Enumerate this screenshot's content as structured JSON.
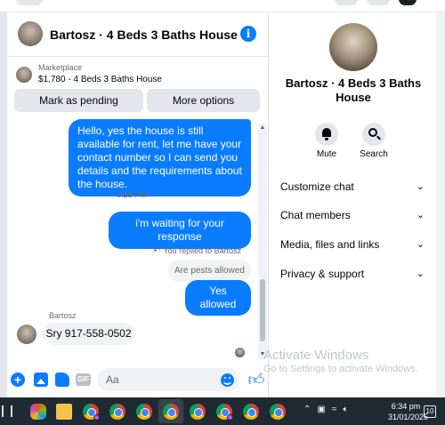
{
  "chat": {
    "title": "Bartosz · 4 Beds 3 Baths House",
    "marketplace_label": "Marketplace",
    "marketplace_item": "$1,780 - 4 Beds 3 Baths House",
    "mark_pending_label": "Mark as pending",
    "more_options_label": "More options"
  },
  "messages": {
    "outgoing_1": "Hello, yes the house is still available for rent, let me have your contact number so I can send you details and the requirements about the house.",
    "timestamp": "6:25 PM",
    "outgoing_2": "i'm waiting for your response",
    "replied_note": "You replied to Bartosz",
    "quoted": "Are pests allowed",
    "outgoing_reply": "Yes allowed",
    "incoming_sender": "Bartosz",
    "incoming_1": "Sry 917-558-0502"
  },
  "composer": {
    "placeholder": "Aa",
    "gif_label": "GIF"
  },
  "info_panel": {
    "title": "Bartosz · 4 Beds 3 Baths House",
    "mute_label": "Mute",
    "search_label": "Search",
    "rows": [
      "Customize chat",
      "Chat members",
      "Media, files and links",
      "Privacy & support"
    ]
  },
  "watermark": {
    "line1": "Activate Windows",
    "line2": "Go to Settings to activate Windows."
  },
  "taskbar": {
    "time": "6:34 pm",
    "date": "31/01/2025",
    "notification_count": "10"
  },
  "icons": {
    "info": "info-icon",
    "plus": "plus-icon",
    "image": "image-icon",
    "sticker": "sticker-icon",
    "emoji": "emoji-icon",
    "like": "thumbs-up-icon",
    "mute": "bell-icon",
    "search": "search-icon"
  },
  "colors": {
    "accent": "#0a7cff",
    "bubble_incoming": "#f0f2f5",
    "taskbar": "#1f2a33"
  }
}
